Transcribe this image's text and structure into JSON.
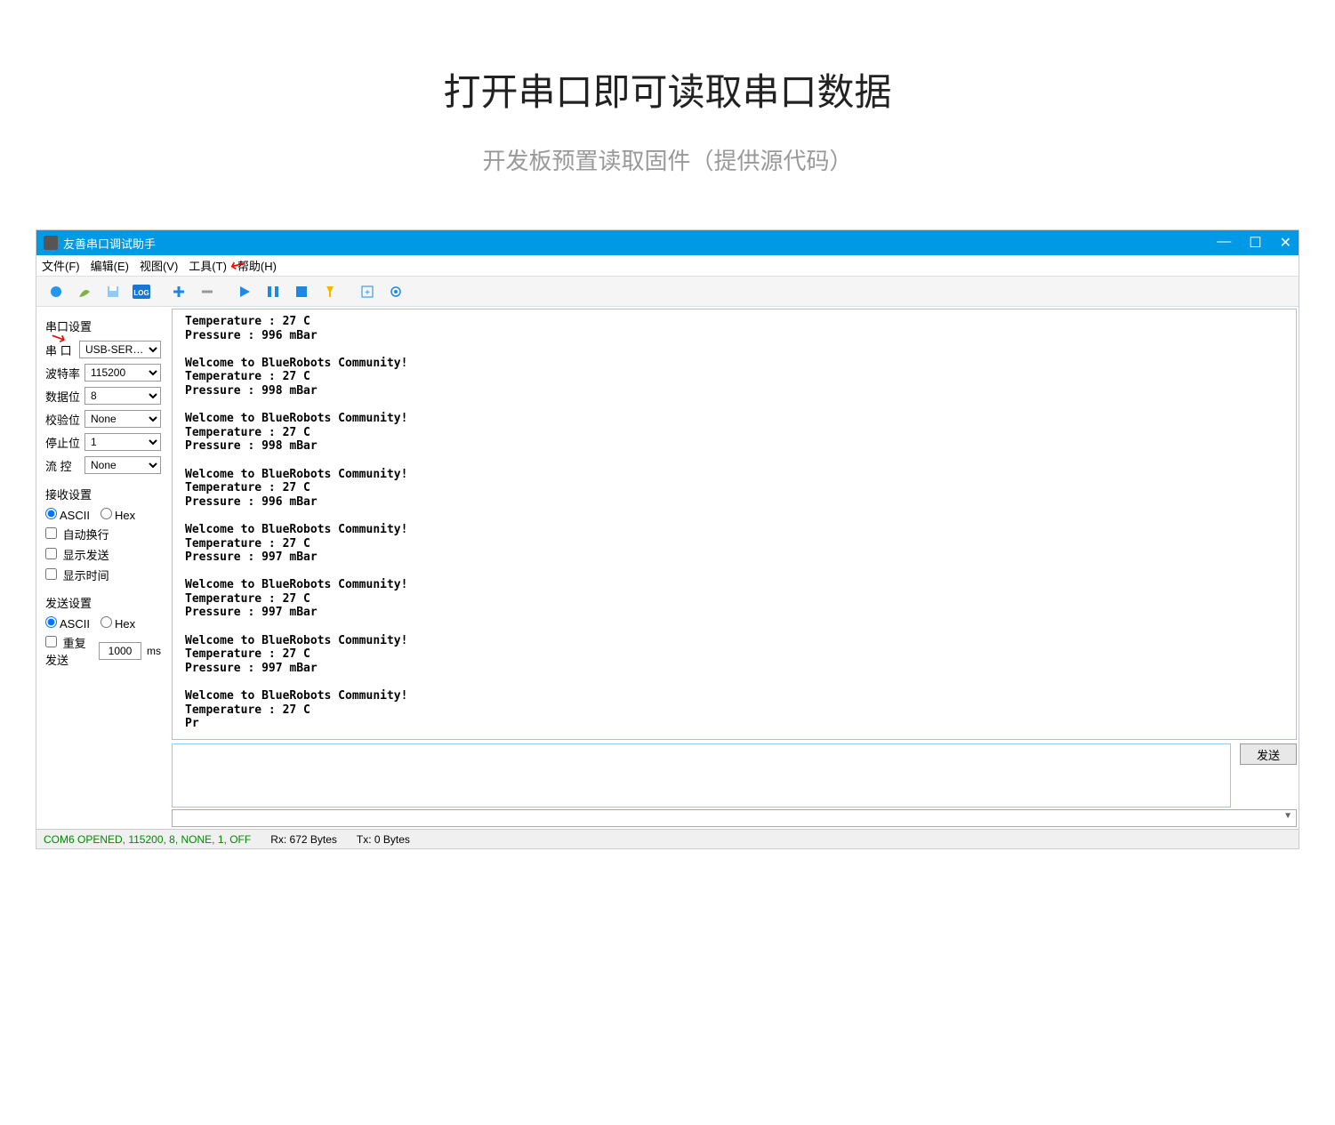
{
  "page": {
    "title": "打开串口即可读取串口数据",
    "subtitle": "开发板预置读取固件（提供源代码）"
  },
  "window": {
    "title": "友善串口调试助手",
    "minimize": "—",
    "maximize": "☐",
    "close": "✕"
  },
  "menu": {
    "file": "文件(F)",
    "edit": "编辑(E)",
    "view": "视图(V)",
    "tools": "工具(T)",
    "help": "帮助(H)"
  },
  "sidebar": {
    "port_settings_title": "串口设置",
    "port_label": "串  口",
    "port_value": "USB-SER…",
    "baud_label": "波特率",
    "baud_value": "115200",
    "databits_label": "数据位",
    "databits_value": "8",
    "parity_label": "校验位",
    "parity_value": "None",
    "stopbits_label": "停止位",
    "stopbits_value": "1",
    "flow_label": "流  控",
    "flow_value": "None",
    "recv_title": "接收设置",
    "ascii_label": "ASCII",
    "hex_label": "Hex",
    "wrap_label": "自动换行",
    "show_send_label": "显示发送",
    "show_time_label": "显示时间",
    "send_title": "发送设置",
    "repeat_label": "重复发送",
    "repeat_value": "1000",
    "repeat_unit": "ms"
  },
  "output": "Temperature : 27 C\nPressure : 996 mBar\n\nWelcome to BlueRobots Community!\nTemperature : 27 C\nPressure : 998 mBar\n\nWelcome to BlueRobots Community!\nTemperature : 27 C\nPressure : 998 mBar\n\nWelcome to BlueRobots Community!\nTemperature : 27 C\nPressure : 996 mBar\n\nWelcome to BlueRobots Community!\nTemperature : 27 C\nPressure : 997 mBar\n\nWelcome to BlueRobots Community!\nTemperature : 27 C\nPressure : 997 mBar\n\nWelcome to BlueRobots Community!\nTemperature : 27 C\nPressure : 997 mBar\n\nWelcome to BlueRobots Community!\nTemperature : 27 C\nPr",
  "send_button": "发送",
  "status": {
    "port": "COM6 OPENED, 115200, 8, NONE, 1, OFF",
    "rx": "Rx: 672 Bytes",
    "tx": "Tx: 0 Bytes"
  }
}
